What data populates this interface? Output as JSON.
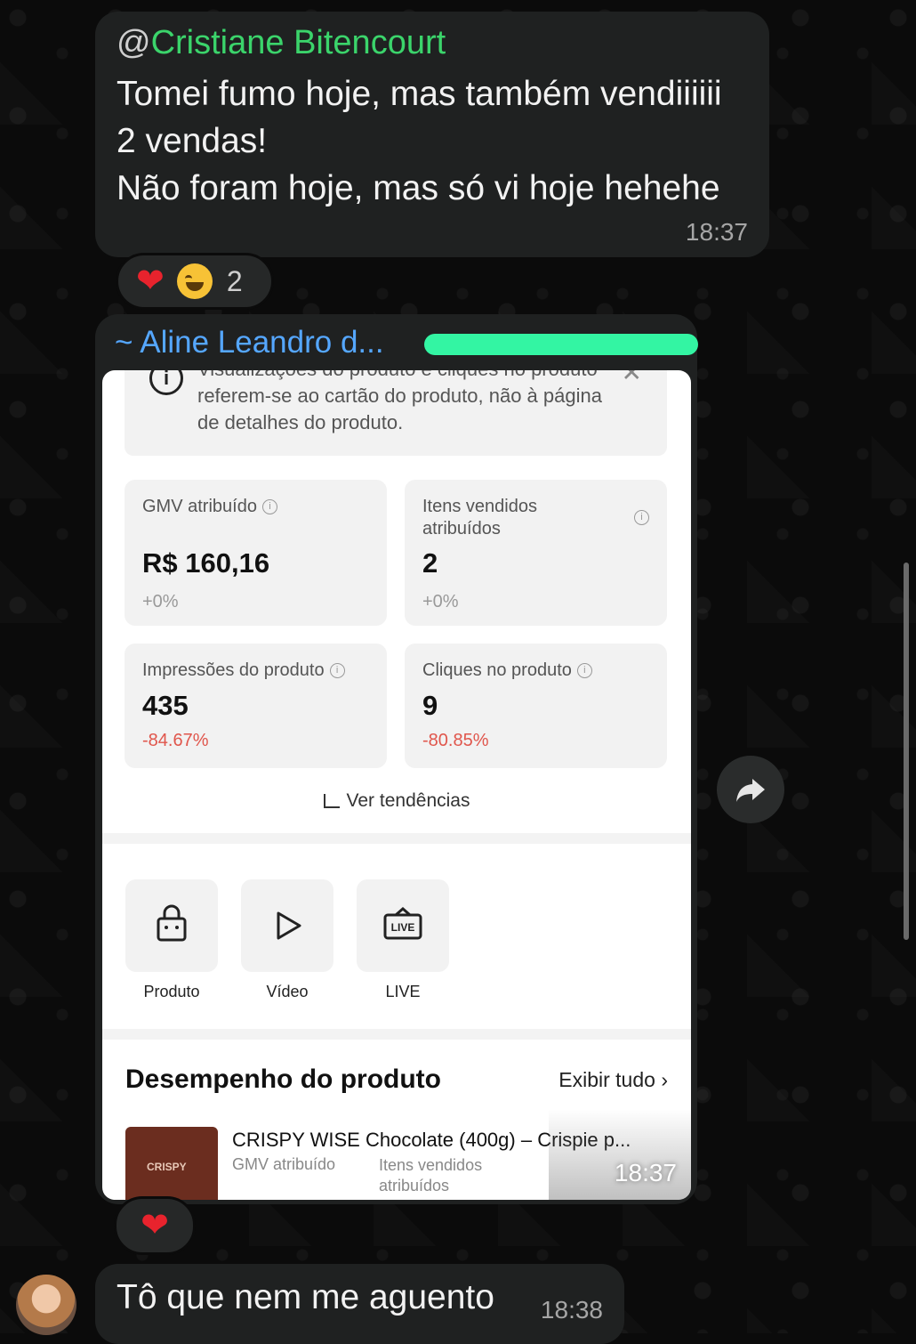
{
  "messages": {
    "m1": {
      "mention_at": "@",
      "mention_name": "Cristiane Bitencourt",
      "line1": "Tomei fumo hoje, mas também vendiiiiii",
      "line2": "2 vendas!",
      "line3": "Não foram hoje, mas só vi hoje hehehe",
      "time": "18:37",
      "reactions": {
        "emojis": [
          "heart",
          "laughing"
        ],
        "count": "2"
      }
    },
    "m2": {
      "sender": "~ Aline Leandro d...",
      "time": "18:37",
      "reactions": {
        "emojis": [
          "heart"
        ]
      },
      "screenshot": {
        "notice": "Visualizações do produto e cliques no produto referem-se ao cartão do produto, não à página de detalhes do produto.",
        "cards": [
          {
            "label": "GMV atribuído",
            "value": "R$ 160,16",
            "delta": "+0%"
          },
          {
            "label": "Itens vendidos atribuídos",
            "value": "2",
            "delta": "+0%"
          },
          {
            "label": "Impressões do produto",
            "value": "435",
            "delta": "-84.67%"
          },
          {
            "label": "Cliques no produto",
            "value": "9",
            "delta": "-80.85%"
          }
        ],
        "trend_link": "Ver tendências",
        "tiles": [
          "Produto",
          "Vídeo",
          "LIVE"
        ],
        "section_title": "Desempenho do produto",
        "view_all": "Exibir tudo",
        "product": {
          "name": "CRISPY WISE Chocolate (400g) – Crispie p...",
          "col1": "GMV atribuído",
          "col2": "Itens vendidos atribuídos",
          "brand": "CRISPY"
        }
      }
    },
    "m3": {
      "text": "Tô que nem me aguento",
      "time": "18:38"
    }
  },
  "colors": {
    "mention": "#3bd46b",
    "sender": "#55a7ff",
    "bubble": "#1f2121",
    "negative": "#e0564c"
  },
  "icons": [
    "heart-icon",
    "laughing-emoji-icon",
    "info-icon",
    "close-icon",
    "trend-icon",
    "shopping-bag-icon",
    "play-icon",
    "live-icon",
    "chevron-right-icon",
    "forward-icon"
  ]
}
